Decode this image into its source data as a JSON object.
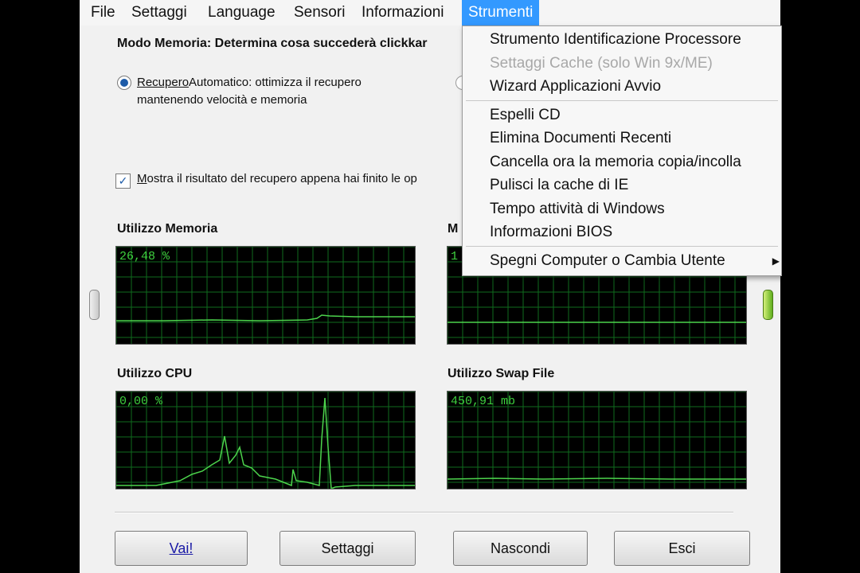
{
  "menubar": {
    "items": [
      "File",
      "Settaggi",
      "Language",
      "Sensori",
      "Informazioni",
      "Strumenti"
    ]
  },
  "mode": {
    "title": "Modo Memoria: Determina cosa succederà clickkar",
    "radio_label_a": "Recupero",
    "radio_label_b": "Automatico: ottimizza il recupero",
    "radio_label_c": "mantenendo velocità e memoria",
    "checkbox_label_a": "M",
    "checkbox_label_b": "ostra il risultato del recupero appena hai finito le op",
    "checkbox_checked": true
  },
  "graphs": {
    "memory": {
      "label": "Utilizzo Memoria",
      "value": "26,48 %"
    },
    "second": {
      "label": "M",
      "value": "1"
    },
    "cpu": {
      "label": "Utilizzo CPU",
      "value": "0,00 %"
    },
    "swap": {
      "label": "Utilizzo Swap File",
      "value": "450,91 mb"
    }
  },
  "buttons": {
    "go": "Vai!",
    "settings": "Settaggi",
    "hide": "Nascondi",
    "exit": "Esci"
  },
  "dropdown": {
    "items": [
      {
        "label": "Strumento Identificazione Processore",
        "enabled": true
      },
      {
        "label": "Settaggi Cache (solo Win 9x/ME)",
        "enabled": false
      },
      {
        "label": "Wizard Applicazioni Avvio",
        "enabled": true
      },
      {
        "label": "Espelli CD",
        "enabled": true
      },
      {
        "label": "Elimina Documenti Recenti",
        "enabled": true
      },
      {
        "label": "Cancella ora la memoria copia/incolla",
        "enabled": true
      },
      {
        "label": "Pulisci la cache di IE",
        "enabled": true
      },
      {
        "label": "Tempo attività di Windows",
        "enabled": true
      },
      {
        "label": "Informazioni BIOS",
        "enabled": true
      },
      {
        "label": "Spegni Computer o Cambia Utente",
        "enabled": true
      }
    ]
  },
  "colors": {
    "graph_line": "#4cd34c",
    "graph_grid": "#0f6b1e",
    "menu_highlight": "#3399ff"
  }
}
